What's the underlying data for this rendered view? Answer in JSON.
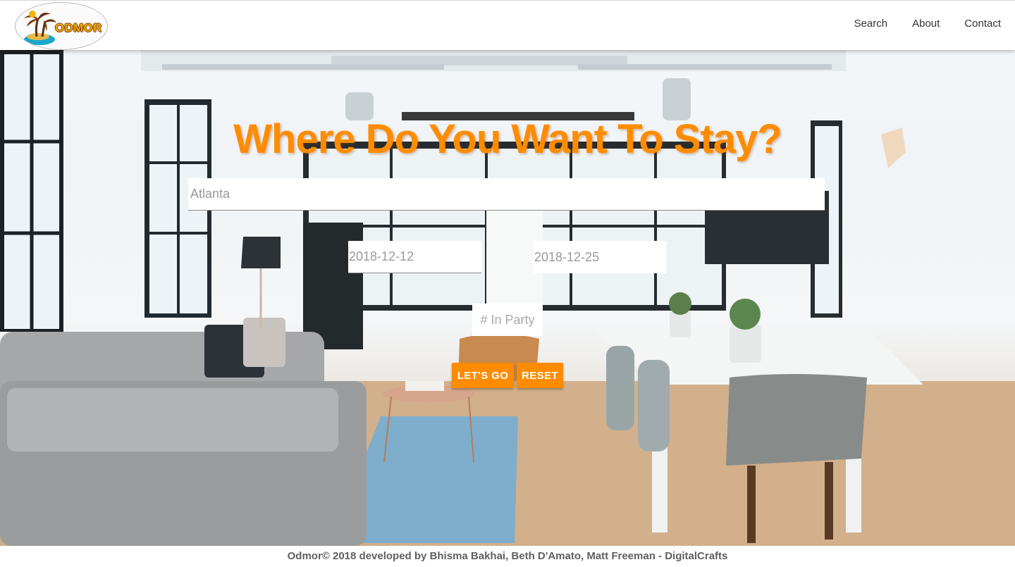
{
  "brand": {
    "logo_text": "ODMOR",
    "logo_icon": "palm-island-icon"
  },
  "nav": {
    "items": [
      "Search",
      "About",
      "Contact"
    ]
  },
  "hero": {
    "headline": "Where Do You Want To Stay?",
    "background": "office-interior-photo"
  },
  "form": {
    "city_value": "Atlanta",
    "checkin_value": "2018-12-12",
    "checkout_value": "2018-12-25",
    "party_placeholder": "# In Party",
    "go_label": "LET'S GO",
    "reset_label": "RESET"
  },
  "footer": {
    "text": "Odmor© 2018 developed by Bhisma Bakhai, Beth D'Amato, Matt Freeman - DigitalCrafts"
  },
  "colors": {
    "accent": "#ff8c00",
    "nav_text": "#333333",
    "footer_text": "#606060"
  }
}
